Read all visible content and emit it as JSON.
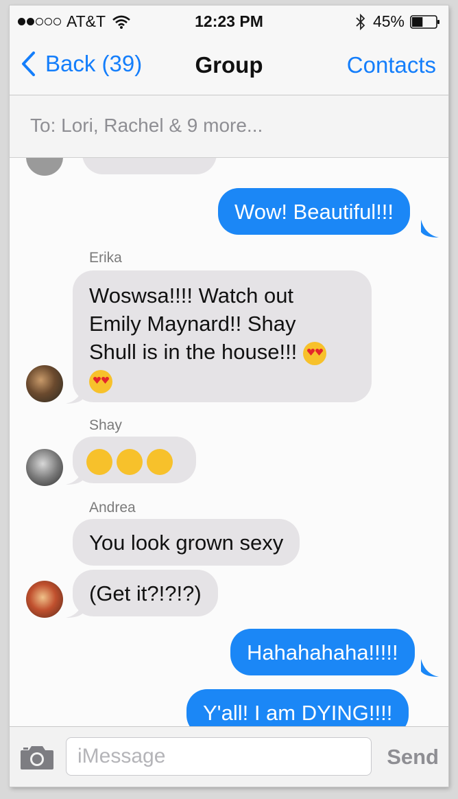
{
  "status_bar": {
    "signal_bars_filled": 2,
    "signal_bars_total": 5,
    "carrier": "AT&T",
    "time": "12:23 PM",
    "battery": "45%",
    "battery_level": 0.45,
    "icons": [
      "wifi-icon",
      "bluetooth-icon",
      "battery-icon"
    ]
  },
  "nav": {
    "back_label": "Back (39)",
    "title": "Group",
    "contacts_label": "Contacts"
  },
  "to_bar": {
    "recipients": "To: Lori, Rachel & 9 more..."
  },
  "messages": [
    {
      "direction": "incoming",
      "text": "",
      "partially_visible": true
    },
    {
      "direction": "outgoing",
      "text": "Wow! Beautiful!!!"
    },
    {
      "direction": "incoming",
      "sender": "Erika",
      "lines": [
        "Woswsa!!!!  Watch out",
        "Emily Maynard!!  Shay",
        "Shull is in the house!!!"
      ],
      "emoji": [
        "smiling-face-with-heart-eyes",
        "smiling-face-with-heart-eyes"
      ]
    },
    {
      "direction": "incoming",
      "sender": "Shay",
      "text": "",
      "emoji": [
        "face-throwing-a-kiss",
        "face-throwing-a-kiss",
        "face-throwing-a-kiss"
      ]
    },
    {
      "direction": "incoming",
      "sender": "Andrea",
      "text": "You look grown sexy"
    },
    {
      "direction": "incoming",
      "text": "(Get it?!?!?)"
    },
    {
      "direction": "outgoing",
      "text": "Hahahahaha!!!!!"
    },
    {
      "direction": "outgoing",
      "text": "Y'all! I am DYING!!!!"
    }
  ],
  "input_bar": {
    "placeholder": "iMessage",
    "value": "",
    "send_label": "Send",
    "camera_icon": "camera-icon"
  },
  "colors": {
    "accent": "#147efb",
    "outgoing_bubble": "#1b87f6",
    "incoming_bubble": "#e5e3e6",
    "bar_background": "#f7f7f7"
  }
}
